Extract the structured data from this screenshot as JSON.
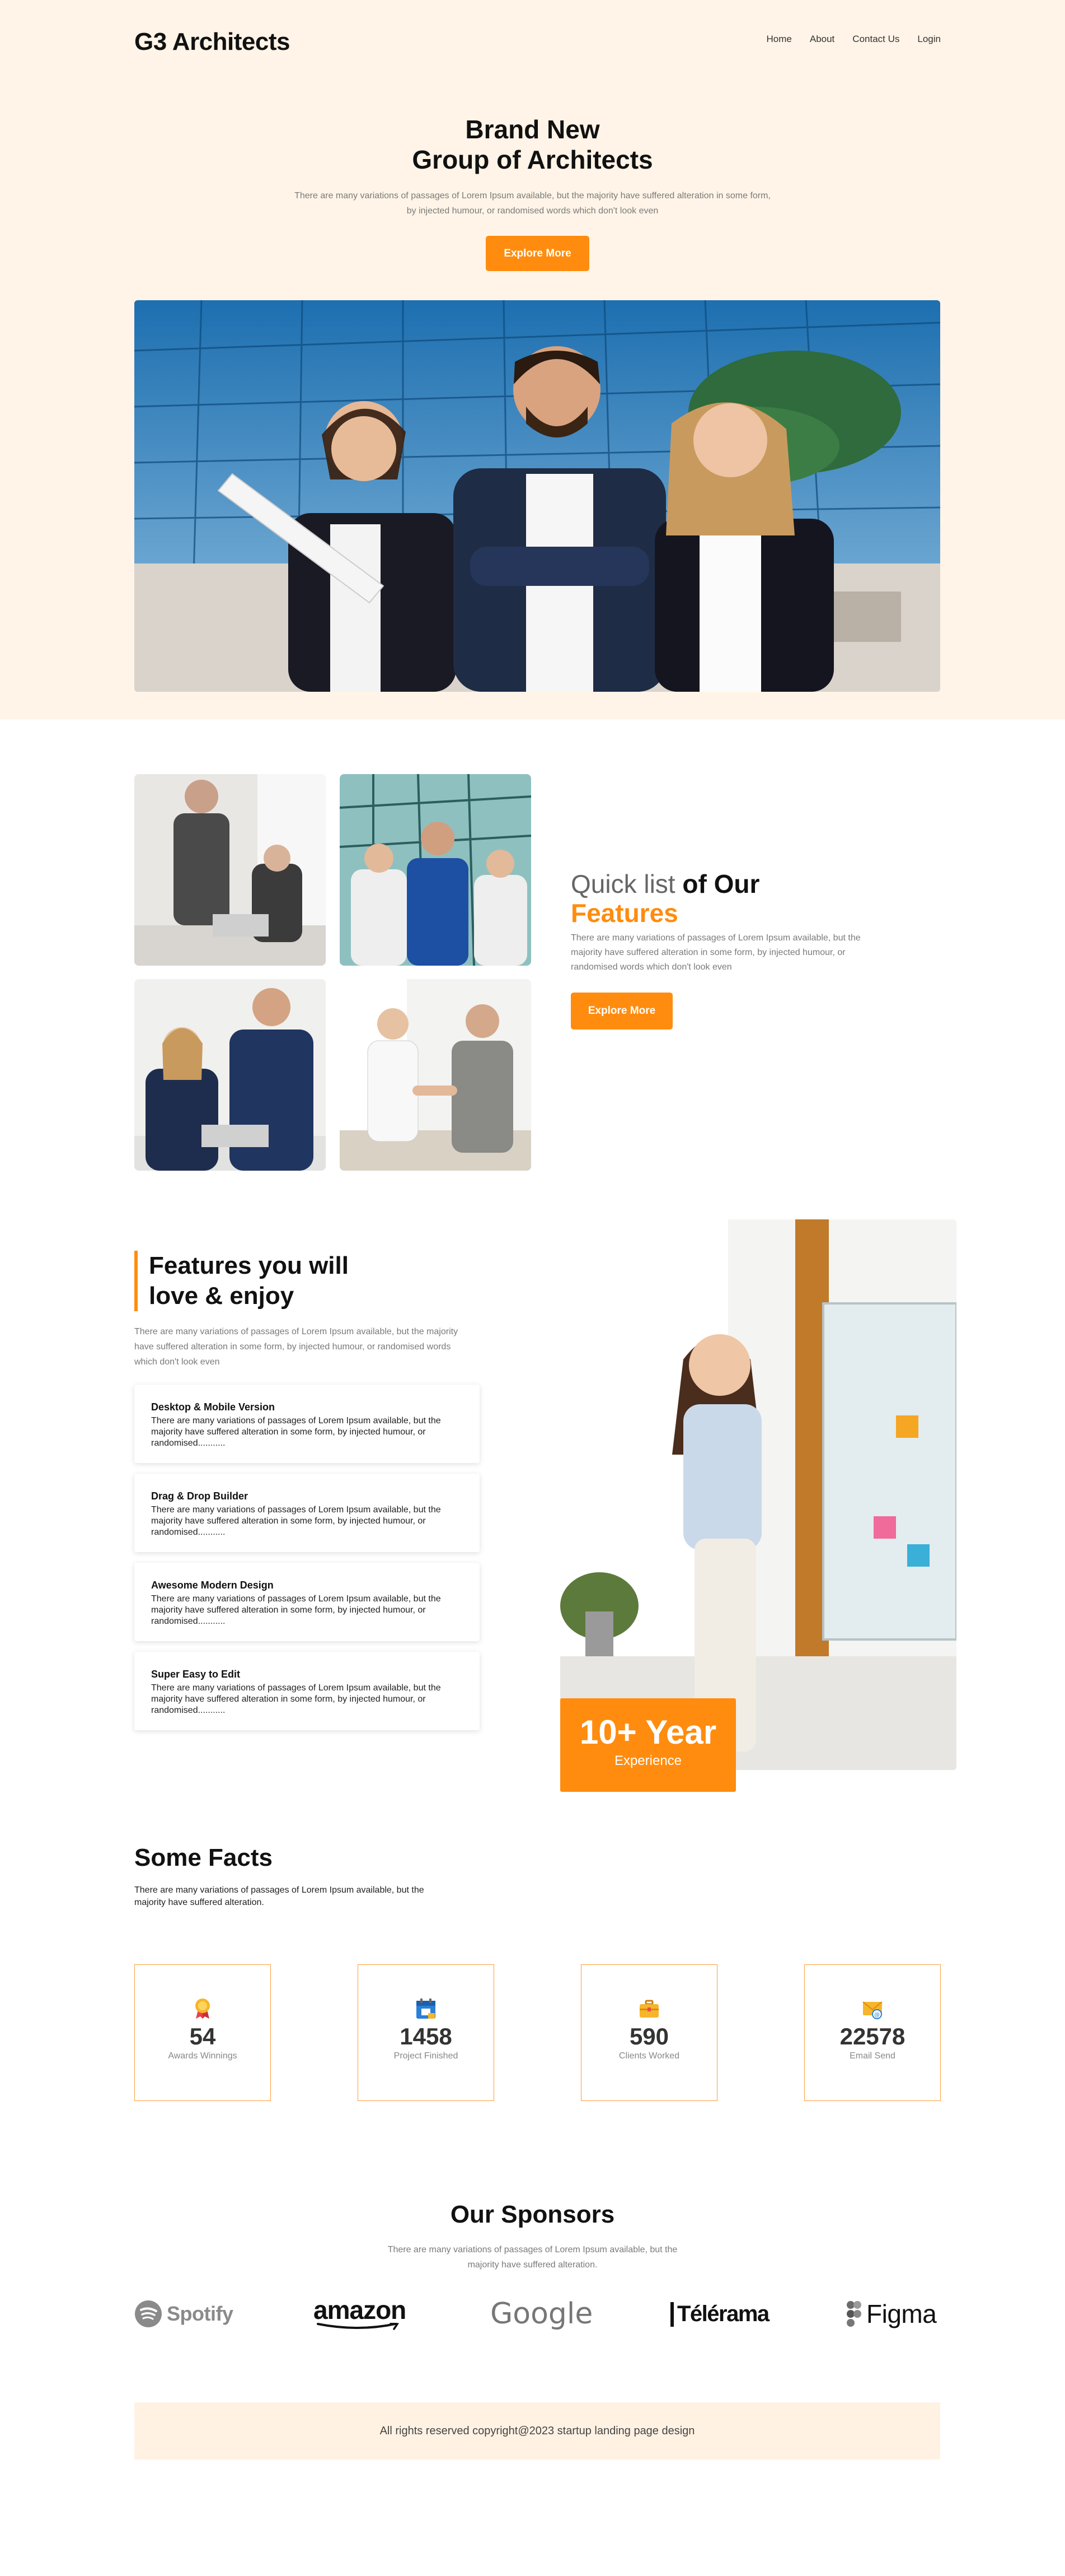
{
  "header": {
    "logo": "G3 Architects",
    "nav": [
      "Home",
      "About",
      "Contact Us",
      "Login"
    ]
  },
  "hero": {
    "title_line1": "Brand New",
    "title_line2": "Group of Architects",
    "subtitle": "There are many variations of passages of Lorem Ipsum available, but the majority have suffered alteration in some form, by injected humour, or randomised words which don't look even",
    "button": "Explore More"
  },
  "quick_list": {
    "title_part1": "Quick list ",
    "title_part2": "of Our",
    "title_part3": "Features",
    "subtitle": "There are many variations of passages of Lorem Ipsum available, but the majority have suffered alteration in some form, by injected humour, or randomised words which don't look even",
    "button": "Explore More"
  },
  "features": {
    "title_line1": "Features you will",
    "title_line2": "love & enjoy",
    "subtitle": "There are many variations of passages of Lorem Ipsum available, but the majority have suffered alteration in some form, by injected humour, or randomised words which don't look even",
    "cards": [
      {
        "title": "Desktop & Mobile Version",
        "text": "There are many variations of passages of Lorem Ipsum available, but the majority have suffered alteration in some form, by injected humour, or randomised..........."
      },
      {
        "title": "Drag & Drop Builder",
        "text": "There are many variations of passages of Lorem Ipsum available, but the majority have suffered alteration in some form, by injected humour, or randomised..........."
      },
      {
        "title": "Awesome Modern Design",
        "text": "There are many variations of passages of Lorem Ipsum available, but the majority have suffered alteration in some form, by injected humour, or randomised..........."
      },
      {
        "title": "Super Easy to Edit",
        "text": "There are many variations of passages of Lorem Ipsum available, but the majority have suffered alteration in some form, by injected humour, or randomised..........."
      }
    ],
    "experience_big": "10+ Year",
    "experience_small": "Experience"
  },
  "facts": {
    "title": "Some Facts",
    "subtitle": "There are many variations of passages of Lorem Ipsum available, but the majority have suffered alteration.",
    "items": [
      {
        "icon": "award-icon",
        "number": "54",
        "label": "Awards Winnings"
      },
      {
        "icon": "calendar-icon",
        "number": "1458",
        "label": "Project Finished"
      },
      {
        "icon": "briefcase-icon",
        "number": "590",
        "label": "Clients Worked"
      },
      {
        "icon": "email-icon",
        "number": "22578",
        "label": "Email Send"
      }
    ]
  },
  "sponsors": {
    "title": "Our Sponsors",
    "subtitle": "There are many variations of passages of Lorem Ipsum available, but the majority have suffered alteration.",
    "logos": [
      "Spotify",
      "amazon",
      "Google",
      "Télérama",
      "Figma"
    ]
  },
  "footer": {
    "text": "All rights reserved copyright@2023 startup landing page design"
  },
  "colors": {
    "accent": "#ff8c0e",
    "hero_bg": "#fff4e7",
    "footer_bg": "#fff2e3"
  }
}
